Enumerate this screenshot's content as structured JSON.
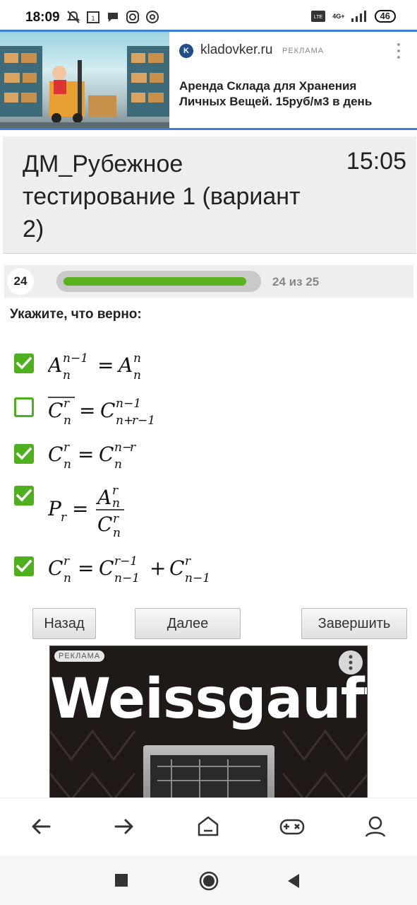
{
  "status_bar": {
    "time": "18:09",
    "network": "4G+",
    "battery": "46",
    "icons": [
      "mute-bell-icon",
      "calendar-icon",
      "chat-icon",
      "instagram-icon",
      "at-icon"
    ]
  },
  "ad_top": {
    "logo_letter": "K",
    "domain": "kladovker.ru",
    "tag": "РЕКЛАМА",
    "text": "Аренда Склада для Хранения Личных Вещей. 15руб/м3 в день"
  },
  "quiz": {
    "title": "ДМ_Рубежное тестирование 1 (вариант 2)",
    "timer": "15:05",
    "question_number": "24",
    "progress_text": "24 из 25",
    "progress_fraction": 0.96,
    "question": "Укажите, что верно:",
    "options": [
      {
        "checked": true
      },
      {
        "checked": false
      },
      {
        "checked": true
      },
      {
        "checked": true
      },
      {
        "checked": true
      }
    ]
  },
  "buttons": {
    "back": "Назад",
    "next": "Далее",
    "finish": "Завершить"
  },
  "ad_bottom": {
    "tag": "РЕКЛАМА",
    "brand": "Weissgauff"
  },
  "colors": {
    "accent_green": "#4db01c",
    "progress_green": "#58b21c",
    "ad_border_blue": "#3f7fd9"
  }
}
